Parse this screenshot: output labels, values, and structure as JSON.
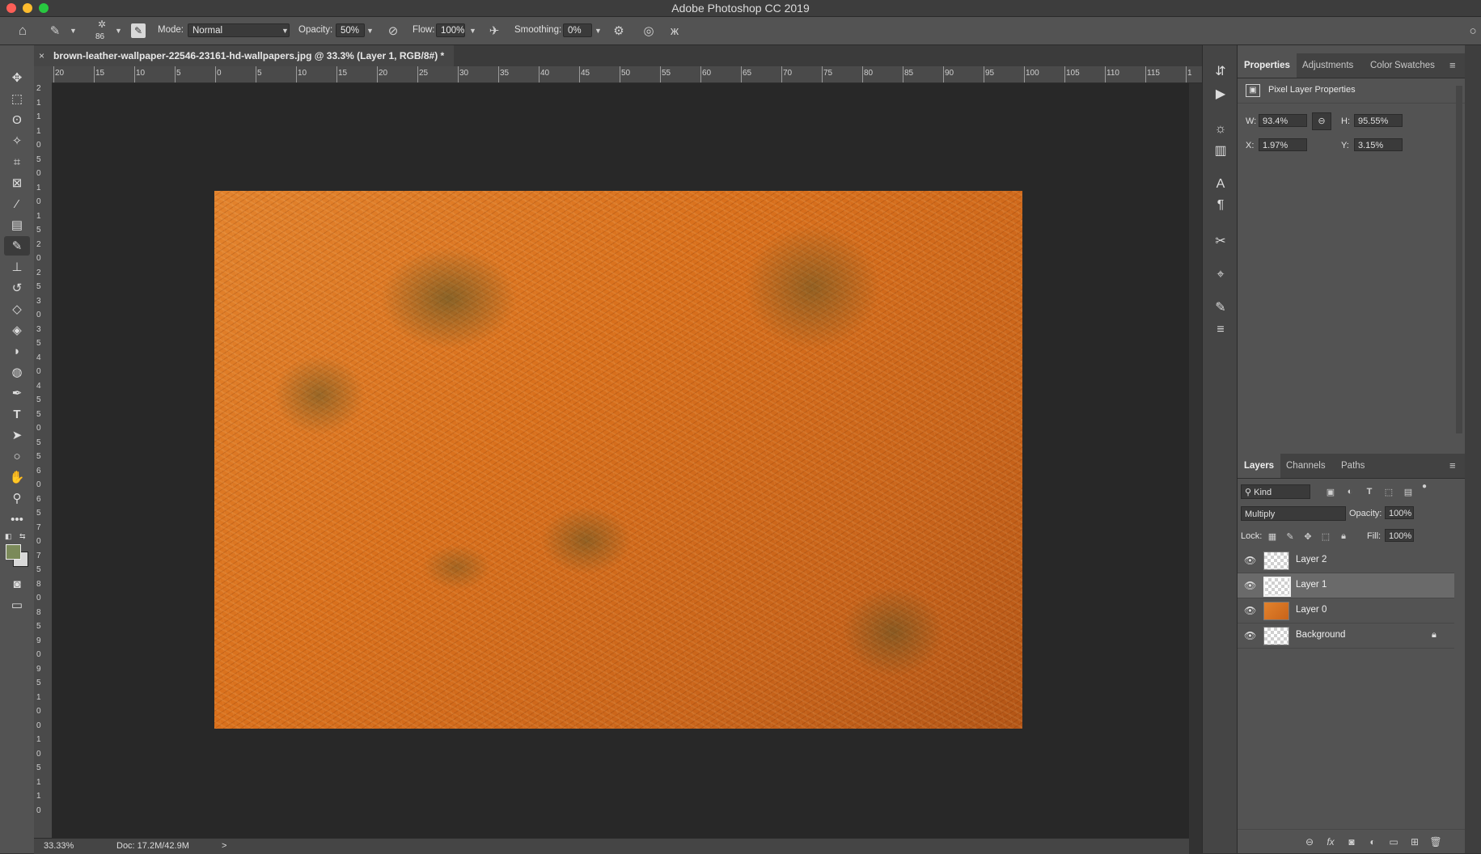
{
  "app": {
    "title": "Adobe Photoshop CC 2019"
  },
  "options_bar": {
    "brush_size": "86",
    "mode_label": "Mode:",
    "mode_value": "Normal",
    "opacity_label": "Opacity:",
    "opacity_value": "50%",
    "flow_label": "Flow:",
    "flow_value": "100%",
    "smoothing_label": "Smoothing:",
    "smoothing_value": "0%"
  },
  "document": {
    "tab_title": "brown-leather-wallpaper-22546-23161-hd-wallpapers.jpg @ 33.3% (Layer 1, RGB/8#) *",
    "close_glyph": "×"
  },
  "ruler": {
    "top_ticks": [
      "20",
      "15",
      "10",
      "5",
      "0",
      "5",
      "10",
      "15",
      "20",
      "25",
      "30",
      "35",
      "40",
      "45",
      "50",
      "55",
      "60",
      "65",
      "70",
      "75",
      "80",
      "85",
      "90",
      "95",
      "100",
      "105",
      "110",
      "115",
      "1"
    ],
    "left_ticks": [
      "2",
      "1",
      "1",
      "1",
      "0",
      "5",
      "0",
      "1",
      "0",
      "1",
      "5",
      "2",
      "0",
      "2",
      "5",
      "3",
      "0",
      "3",
      "5",
      "4",
      "0",
      "4",
      "5",
      "5",
      "0",
      "5",
      "5",
      "6",
      "0",
      "6",
      "5",
      "7",
      "0",
      "7",
      "5",
      "8",
      "0",
      "8",
      "5",
      "9",
      "0",
      "9",
      "5",
      "1",
      "0",
      "0",
      "1",
      "0",
      "5",
      "1",
      "1",
      "0"
    ]
  },
  "status": {
    "zoom": "33.33%",
    "doc": "Doc: 17.2M/42.9M",
    "arrow": ">"
  },
  "properties": {
    "tabs": [
      "Properties",
      "Adjustments",
      "Color",
      "Swatches"
    ],
    "section_title": "Pixel Layer Properties",
    "w_label": "W:",
    "w_value": "93.4%",
    "h_label": "H:",
    "h_value": "95.55%",
    "x_label": "X:",
    "x_value": "1.97%",
    "y_label": "Y:",
    "y_value": "3.15%"
  },
  "layers_panel": {
    "tabs": [
      "Layers",
      "Channels",
      "Paths"
    ],
    "filter_kind": "Kind",
    "blend_mode": "Multiply",
    "opacity_label": "Opacity:",
    "opacity_value": "100%",
    "lock_label": "Lock:",
    "fill_label": "Fill:",
    "fill_value": "100%",
    "layers": [
      {
        "name": "Layer 2",
        "selected": false,
        "thumb": "transparent"
      },
      {
        "name": "Layer 1",
        "selected": true,
        "thumb": "transparent"
      },
      {
        "name": "Layer 0",
        "selected": false,
        "thumb": "leather"
      },
      {
        "name": "Background",
        "selected": false,
        "thumb": "transparent",
        "locked": true
      }
    ]
  },
  "colors": {
    "foreground": "#7b8a5a",
    "background": "#d8d8d8",
    "accent": "#2d7be3"
  }
}
